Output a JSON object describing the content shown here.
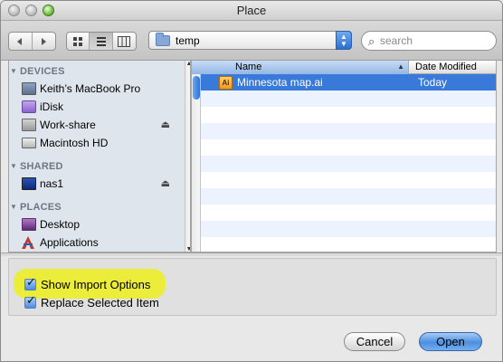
{
  "window": {
    "title": "Place"
  },
  "toolbar": {
    "nav": {
      "back_icon": "back-arrow-icon",
      "forward_icon": "forward-arrow-icon"
    },
    "views": [
      "icon-view-icon",
      "list-view-icon",
      "column-view-icon"
    ],
    "active_view": "list-view-icon",
    "location": "temp",
    "search": {
      "placeholder": "search",
      "value": ""
    }
  },
  "sidebar": {
    "sections": [
      {
        "label": "DEVICES",
        "items": [
          {
            "label": "Keith’s MacBook Pro",
            "icon": "laptop-icon",
            "eject": false
          },
          {
            "label": "iDisk",
            "icon": "idisk-icon",
            "eject": false
          },
          {
            "label": "Work-share",
            "icon": "network-share-icon",
            "eject": true
          },
          {
            "label": "Macintosh HD",
            "icon": "hard-drive-icon",
            "eject": false
          }
        ]
      },
      {
        "label": "SHARED",
        "items": [
          {
            "label": "nas1",
            "icon": "server-icon",
            "eject": true
          }
        ]
      },
      {
        "label": "PLACES",
        "items": [
          {
            "label": "Desktop",
            "icon": "desktop-folder-icon",
            "eject": false
          },
          {
            "label": "Applications",
            "icon": "applications-icon",
            "eject": false
          }
        ]
      }
    ],
    "eject_glyph": "⏏"
  },
  "filelist": {
    "columns": {
      "name": "Name",
      "date": "Date Modified"
    },
    "files": [
      {
        "name": "Minnesota map.ai",
        "date": "Today",
        "icon_label": "Ai",
        "selected": true
      }
    ]
  },
  "options": {
    "show_import": {
      "label": "Show Import Options",
      "checked": true
    },
    "replace_selected": {
      "label": "Replace Selected Item",
      "checked": true
    }
  },
  "buttons": {
    "cancel": "Cancel",
    "open": "Open"
  },
  "colors": {
    "selection": "#3879d9",
    "highlight": "#ecec3b",
    "sidebar_bg": "#dfe5ed"
  }
}
